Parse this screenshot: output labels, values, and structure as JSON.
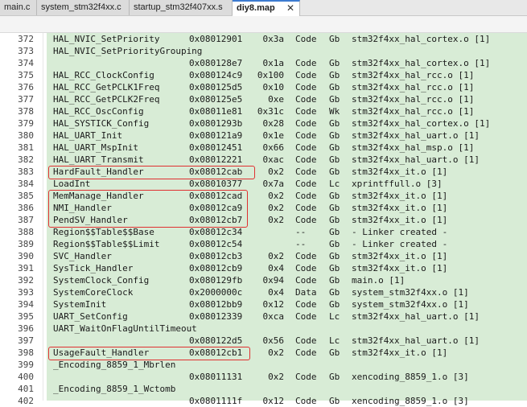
{
  "tabs": [
    {
      "label": "main.c",
      "active": false
    },
    {
      "label": "system_stm32f4xx.c",
      "active": false
    },
    {
      "label": "startup_stm32f407xx.s",
      "active": false
    },
    {
      "label": "diy8.map",
      "active": true,
      "close": "✕"
    }
  ],
  "rows": [
    {
      "ln": "372",
      "name": "HAL_NVIC_SetPriority",
      "addr": "0x08012901",
      "size": "0x3a",
      "type": "Code",
      "attr": "Gb",
      "obj": "stm32f4xx_hal_cortex.o [1]"
    },
    {
      "ln": "373",
      "name": "HAL_NVIC_SetPriorityGrouping",
      "addr": "",
      "size": "",
      "type": "",
      "attr": "",
      "obj": ""
    },
    {
      "ln": "374",
      "name": "",
      "addr": "0x080128e7",
      "size": "0x1a",
      "type": "Code",
      "attr": "Gb",
      "obj": "stm32f4xx_hal_cortex.o [1]"
    },
    {
      "ln": "375",
      "name": "HAL_RCC_ClockConfig",
      "addr": "0x080124c9",
      "size": "0x100",
      "type": "Code",
      "attr": "Gb",
      "obj": "stm32f4xx_hal_rcc.o [1]"
    },
    {
      "ln": "376",
      "name": "HAL_RCC_GetPCLK1Freq",
      "addr": "0x080125d5",
      "size": "0x10",
      "type": "Code",
      "attr": "Gb",
      "obj": "stm32f4xx_hal_rcc.o [1]"
    },
    {
      "ln": "377",
      "name": "HAL_RCC_GetPCLK2Freq",
      "addr": "0x080125e5",
      "size": "0xe",
      "type": "Code",
      "attr": "Gb",
      "obj": "stm32f4xx_hal_rcc.o [1]"
    },
    {
      "ln": "378",
      "name": "HAL_RCC_OscConfig",
      "addr": "0x08011e81",
      "size": "0x31c",
      "type": "Code",
      "attr": "Wk",
      "obj": "stm32f4xx_hal_rcc.o [1]"
    },
    {
      "ln": "379",
      "name": "HAL_SYSTICK_Config",
      "addr": "0x0801293b",
      "size": "0x28",
      "type": "Code",
      "attr": "Gb",
      "obj": "stm32f4xx_hal_cortex.o [1]"
    },
    {
      "ln": "380",
      "name": "HAL_UART_Init",
      "addr": "0x080121a9",
      "size": "0x1e",
      "type": "Code",
      "attr": "Gb",
      "obj": "stm32f4xx_hal_uart.o [1]"
    },
    {
      "ln": "381",
      "name": "HAL_UART_MspInit",
      "addr": "0x08012451",
      "size": "0x66",
      "type": "Code",
      "attr": "Gb",
      "obj": "stm32f4xx_hal_msp.o [1]"
    },
    {
      "ln": "382",
      "name": "HAL_UART_Transmit",
      "addr": "0x08012221",
      "size": "0xac",
      "type": "Code",
      "attr": "Gb",
      "obj": "stm32f4xx_hal_uart.o [1]"
    },
    {
      "ln": "383",
      "name": "HardFault_Handler",
      "addr": "0x08012cab",
      "size": "0x2",
      "type": "Code",
      "attr": "Gb",
      "obj": "stm32f4xx_it.o [1]"
    },
    {
      "ln": "384",
      "name": "LoadInt",
      "addr": "0x08010377",
      "size": "0x7a",
      "type": "Code",
      "attr": "Lc",
      "obj": "xprintffull.o [3]"
    },
    {
      "ln": "385",
      "name": "MemManage_Handler",
      "addr": "0x08012cad",
      "size": "0x2",
      "type": "Code",
      "attr": "Gb",
      "obj": "stm32f4xx_it.o [1]"
    },
    {
      "ln": "386",
      "name": "NMI_Handler",
      "addr": "0x08012ca9",
      "size": "0x2",
      "type": "Code",
      "attr": "Gb",
      "obj": "stm32f4xx_it.o [1]"
    },
    {
      "ln": "387",
      "name": "PendSV_Handler",
      "addr": "0x08012cb7",
      "size": "0x2",
      "type": "Code",
      "attr": "Gb",
      "obj": "stm32f4xx_it.o [1]"
    },
    {
      "ln": "388",
      "name": "Region$$Table$$Base",
      "addr": "0x08012c34",
      "size": "",
      "type": "--",
      "attr": "Gb",
      "obj": "- Linker created -"
    },
    {
      "ln": "389",
      "name": "Region$$Table$$Limit",
      "addr": "0x08012c54",
      "size": "",
      "type": "--",
      "attr": "Gb",
      "obj": "- Linker created -"
    },
    {
      "ln": "390",
      "name": "SVC_Handler",
      "addr": "0x08012cb3",
      "size": "0x2",
      "type": "Code",
      "attr": "Gb",
      "obj": "stm32f4xx_it.o [1]"
    },
    {
      "ln": "391",
      "name": "SysTick_Handler",
      "addr": "0x08012cb9",
      "size": "0x4",
      "type": "Code",
      "attr": "Gb",
      "obj": "stm32f4xx_it.o [1]"
    },
    {
      "ln": "392",
      "name": "SystemClock_Config",
      "addr": "0x080129fb",
      "size": "0x94",
      "type": "Code",
      "attr": "Gb",
      "obj": "main.o [1]"
    },
    {
      "ln": "393",
      "name": "SystemCoreClock",
      "addr": "0x2000000c",
      "size": "0x4",
      "type": "Data",
      "attr": "Gb",
      "obj": "system_stm32f4xx.o [1]"
    },
    {
      "ln": "394",
      "name": "SystemInit",
      "addr": "0x08012bb9",
      "size": "0x12",
      "type": "Code",
      "attr": "Gb",
      "obj": "system_stm32f4xx.o [1]"
    },
    {
      "ln": "395",
      "name": "UART_SetConfig",
      "addr": "0x08012339",
      "size": "0xca",
      "type": "Code",
      "attr": "Lc",
      "obj": "stm32f4xx_hal_uart.o [1]"
    },
    {
      "ln": "396",
      "name": "UART_WaitOnFlagUntilTimeout",
      "addr": "",
      "size": "",
      "type": "",
      "attr": "",
      "obj": ""
    },
    {
      "ln": "397",
      "name": "",
      "addr": "0x080122d5",
      "size": "0x56",
      "type": "Code",
      "attr": "Lc",
      "obj": "stm32f4xx_hal_uart.o [1]"
    },
    {
      "ln": "398",
      "name": "UsageFault_Handler",
      "addr": "0x08012cb1",
      "size": "0x2",
      "type": "Code",
      "attr": "Gb",
      "obj": "stm32f4xx_it.o [1]"
    },
    {
      "ln": "399",
      "name": "_Encoding_8859_1_Mbrlen",
      "addr": "",
      "size": "",
      "type": "",
      "attr": "",
      "obj": ""
    },
    {
      "ln": "400",
      "name": "",
      "addr": "0x08011131",
      "size": "0x2",
      "type": "Code",
      "attr": "Gb",
      "obj": "xencoding_8859_1.o [3]"
    },
    {
      "ln": "401",
      "name": "_Encoding_8859_1_Wctomb",
      "addr": "",
      "size": "",
      "type": "",
      "attr": "",
      "obj": ""
    },
    {
      "ln": "402",
      "name": "",
      "addr": "0x0801111f",
      "size": "0x12",
      "type": "Code",
      "attr": "Gb",
      "obj": "xencoding_8859_1.o [3]"
    }
  ],
  "highlight_color": "#e03030"
}
